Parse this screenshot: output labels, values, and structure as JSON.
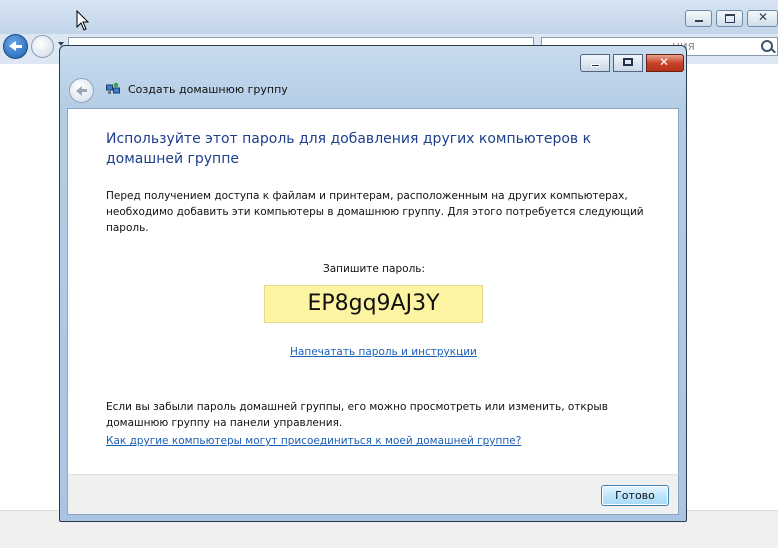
{
  "background_window": {
    "search_placeholder": "ния"
  },
  "dialog": {
    "title": "Создать домашнюю группу",
    "heading": "Используйте этот пароль для добавления других компьютеров к домашней группе",
    "description": "Перед получением доступа к файлам и принтерам, расположенным на других компьютерах, необходимо добавить эти компьютеры в домашнюю группу. Для этого потребуется следующий пароль.",
    "password_label": "Запишите пароль:",
    "password": "EP8gq9AJ3Y",
    "print_link": "Напечатать пароль и инструкции",
    "forgot_note": "Если вы забыли пароль домашней группы, его можно просмотреть или изменить, открыв домашнюю группу на панели управления.",
    "join_link": "Как другие компьютеры могут присоединиться к моей домашней группе?",
    "done_button": "Готово"
  },
  "colors": {
    "heading": "#1e3f8c",
    "link": "#1b5fb5",
    "password_bg": "#fdf4a1",
    "close_button": "#c8432a"
  },
  "icons": [
    "homegroup-icon",
    "back-arrow-icon",
    "search-icon",
    "close-icon",
    "minimize-icon",
    "maximize-icon",
    "mouse-cursor-icon"
  ]
}
